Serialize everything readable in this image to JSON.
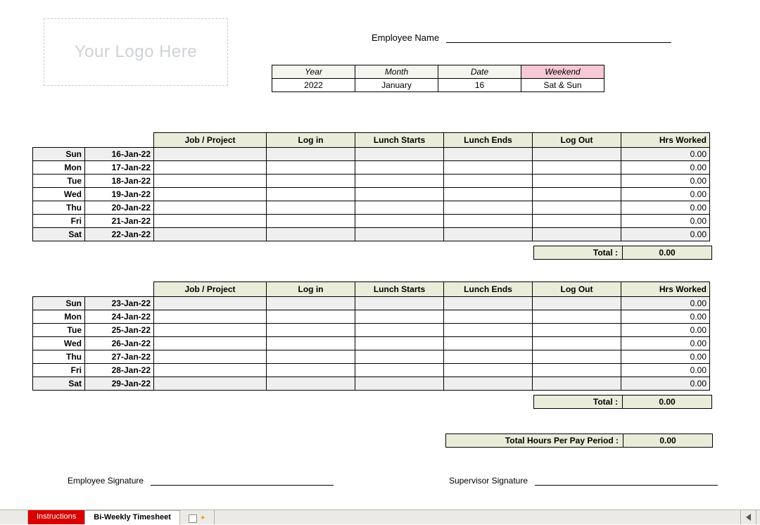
{
  "logo_placeholder": "Your Logo Here",
  "employee_name_label": "Employee Name",
  "meta": {
    "headers": {
      "year": "Year",
      "month": "Month",
      "date": "Date",
      "weekend": "Weekend"
    },
    "values": {
      "year": "2022",
      "month": "January",
      "date": "16",
      "weekend": "Sat & Sun"
    }
  },
  "columns": {
    "job": "Job / Project",
    "login": "Log in",
    "lunch_start": "Lunch Starts",
    "lunch_end": "Lunch Ends",
    "logout": "Log Out",
    "hrs": "Hrs Worked"
  },
  "week1": {
    "rows": [
      {
        "day": "Sun",
        "date": "16-Jan-22",
        "hrs": "0.00"
      },
      {
        "day": "Mon",
        "date": "17-Jan-22",
        "hrs": "0.00"
      },
      {
        "day": "Tue",
        "date": "18-Jan-22",
        "hrs": "0.00"
      },
      {
        "day": "Wed",
        "date": "19-Jan-22",
        "hrs": "0.00"
      },
      {
        "day": "Thu",
        "date": "20-Jan-22",
        "hrs": "0.00"
      },
      {
        "day": "Fri",
        "date": "21-Jan-22",
        "hrs": "0.00"
      },
      {
        "day": "Sat",
        "date": "22-Jan-22",
        "hrs": "0.00"
      }
    ],
    "total_label": "Total :",
    "total": "0.00"
  },
  "week2": {
    "rows": [
      {
        "day": "Sun",
        "date": "23-Jan-22",
        "hrs": "0.00"
      },
      {
        "day": "Mon",
        "date": "24-Jan-22",
        "hrs": "0.00"
      },
      {
        "day": "Tue",
        "date": "25-Jan-22",
        "hrs": "0.00"
      },
      {
        "day": "Wed",
        "date": "26-Jan-22",
        "hrs": "0.00"
      },
      {
        "day": "Thu",
        "date": "27-Jan-22",
        "hrs": "0.00"
      },
      {
        "day": "Fri",
        "date": "28-Jan-22",
        "hrs": "0.00"
      },
      {
        "day": "Sat",
        "date": "29-Jan-22",
        "hrs": "0.00"
      }
    ],
    "total_label": "Total :",
    "total": "0.00"
  },
  "grand_total_label": "Total Hours Per Pay Period :",
  "grand_total": "0.00",
  "sig": {
    "employee": "Employee Signature",
    "supervisor": "Supervisor Signature"
  },
  "tabs": {
    "instructions": "Instructions",
    "active": "Bi-Weekly Timesheet"
  }
}
